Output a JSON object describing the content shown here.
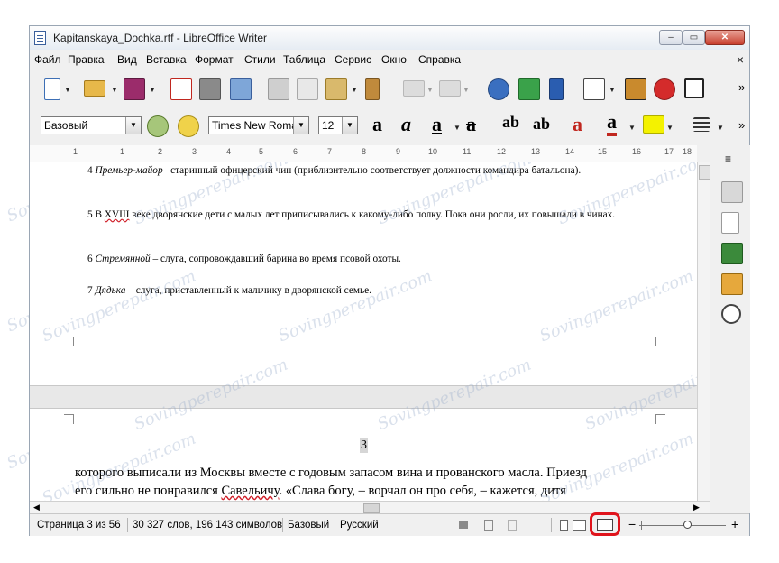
{
  "window": {
    "title": "Kapitanskaya_Dochka.rtf - LibreOffice Writer",
    "minimize_glyph": "‒",
    "maximize_glyph": "▭",
    "close_glyph": "✕"
  },
  "menu": {
    "items": [
      "Файл",
      "Правка",
      "Вид",
      "Вставка",
      "Формат",
      "Стили",
      "Таблица",
      "Сервис",
      "Окно",
      "Справка"
    ],
    "close_glyph": "×"
  },
  "toolbar": {
    "overflow_glyph": "»"
  },
  "formatting": {
    "style": "Базовый",
    "font": "Times New Roma",
    "size": "12",
    "bold_glyph": "a",
    "italic_glyph": "a",
    "underline_glyph": "a",
    "strike_glyph": "a",
    "superscript_glyph": "ab",
    "subscript_glyph": "ab",
    "clear_glyph": "a",
    "font_color_glyph": "a"
  },
  "ruler": {
    "ticks": [
      "1",
      "1",
      "2",
      "3",
      "4",
      "5",
      "6",
      "7",
      "8",
      "9",
      "10",
      "11",
      "12",
      "13",
      "14",
      "15",
      "16",
      "17",
      "18"
    ]
  },
  "document": {
    "footnotes": [
      {
        "num": "4",
        "term": "Премьер-майор",
        "text": "– старинный офицерский чин (приблизительно соответствует должности командира батальона)."
      },
      {
        "num": "5",
        "prefix": "В",
        "term": "XVIII",
        "text": "веке дворянские дети с малых лет приписывались к какому-либо полку. Пока они росли, их повышали в чинах."
      },
      {
        "num": "6",
        "term": "Стремянной",
        "text": "– слуга, сопровождавший барина во время псовой охоты."
      },
      {
        "num": "7",
        "term": "Дядька",
        "text": "– слуга, приставленный к мальчику в дворянской семье."
      }
    ],
    "page_number": "3",
    "body_line1": "которого выписали из Москвы вместе с годовым запасом вина и прованского масла. Приезд",
    "body_line2a": "его сильно не понравился",
    "body_line2_name": "Савельичу",
    "body_line2b": ". «Слава богу, – ворчал он про себя, – кажется, дитя"
  },
  "watermark": "Sovingperepair.com",
  "statusbar": {
    "page": "Страница 3 из 56",
    "words": "30 327 слов, 196 143 символов",
    "style": "Базовый",
    "language": "Русский",
    "zoom_minus": "−",
    "zoom_plus": "+",
    "zoom_level": 0.55
  },
  "colors": {
    "highlight": "#e0141c",
    "accent_blue": "#2a5db0"
  }
}
